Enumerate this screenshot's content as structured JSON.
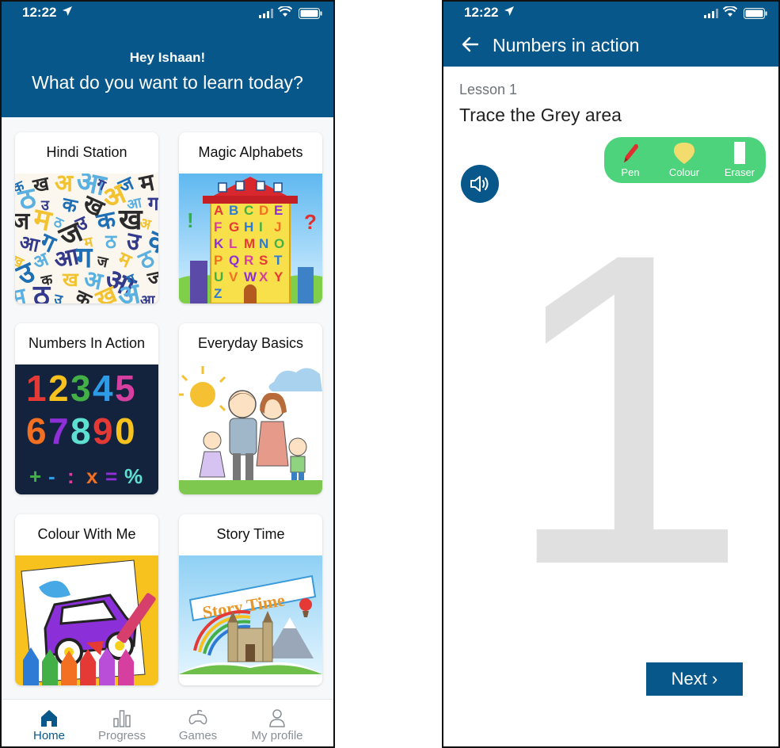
{
  "colors": {
    "brand_blue": "#07578a",
    "tool_green": "#4cd37c",
    "trace_grey": "#e0e0e0",
    "inactive_tab": "#8a8f96"
  },
  "home_screen": {
    "status_bar": {
      "time": "12:22"
    },
    "header": {
      "greeting": "Hey Ishaan!",
      "question": "What do you want to learn today?"
    },
    "cards": [
      {
        "title": "Hindi Station",
        "image": "hindi-letters-collage"
      },
      {
        "title": "Magic Alphabets",
        "image": "alphabet-building"
      },
      {
        "title": "Numbers In Action",
        "image": "colorful-numbers"
      },
      {
        "title": "Everyday Basics",
        "image": "family-drawing"
      },
      {
        "title": "Colour With Me",
        "image": "car-coloring-crayons"
      },
      {
        "title": "Story Time",
        "image": "story-book-castle"
      }
    ],
    "card_art": {
      "alphabet_letters": [
        "A",
        "B",
        "C",
        "D",
        "E",
        "F",
        "G",
        "H",
        "I",
        "J",
        "K",
        "L",
        "M",
        "N",
        "O",
        "P",
        "Q",
        "R",
        "S",
        "T",
        "U",
        "V",
        "W",
        "X",
        "Y",
        "Z"
      ],
      "numbers_rows": [
        "12345",
        "67890",
        "+-:x=%"
      ],
      "hindi_glyphs": [
        "क",
        "ख",
        "अ",
        "आ",
        "ग",
        "ज",
        "म",
        "ठ",
        "उ"
      ],
      "story_banner": "Story Time"
    },
    "tab_bar": [
      {
        "label": "Home",
        "icon": "home-icon",
        "active": true
      },
      {
        "label": "Progress",
        "icon": "bar-chart-icon",
        "active": false
      },
      {
        "label": "Games",
        "icon": "gamepad-icon",
        "active": false
      },
      {
        "label": "My profile",
        "icon": "person-icon",
        "active": false
      }
    ]
  },
  "lesson_screen": {
    "status_bar": {
      "time": "12:22"
    },
    "app_bar": {
      "title": "Numbers in action"
    },
    "lesson_number": "Lesson 1",
    "instruction": "Trace the Grey area",
    "tools": [
      {
        "label": "Pen",
        "icon": "pen-icon"
      },
      {
        "label": "Colour",
        "icon": "colour-blob-icon"
      },
      {
        "label": "Eraser",
        "icon": "eraser-icon"
      }
    ],
    "trace_digit": "1",
    "next_button": "Next ›"
  }
}
